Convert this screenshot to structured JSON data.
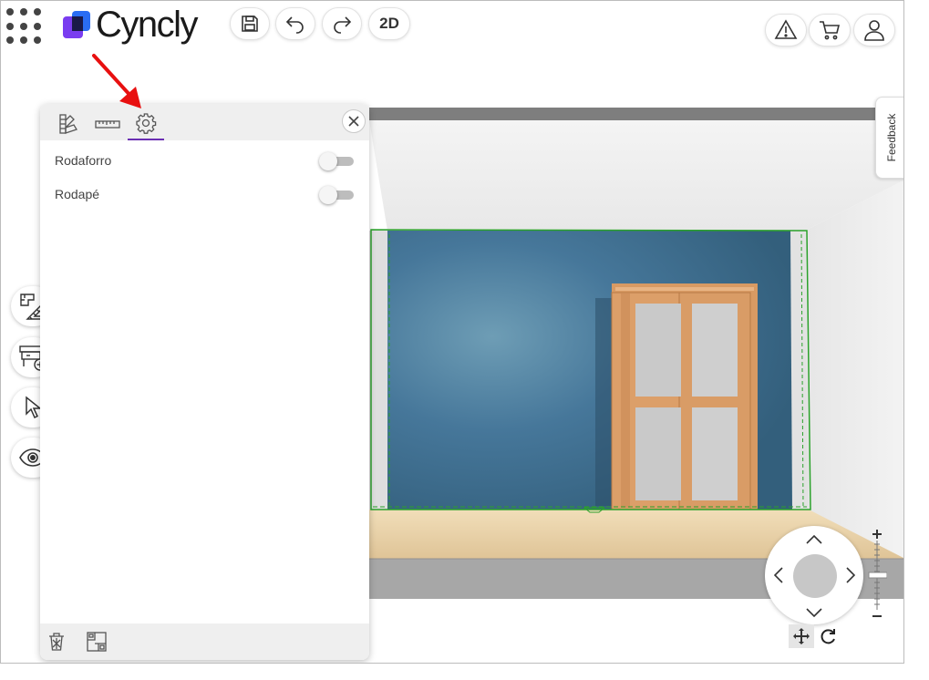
{
  "app": {
    "brand": "Cyncly",
    "colors": {
      "brand_purple": "#7a3df0",
      "brand_blue": "#2a6df4",
      "active_tab": "#6b2fb3",
      "wall": "#3d6b86",
      "floor": "#e7cfa5",
      "selection": "#2aa12a",
      "annotation": "#e81010"
    }
  },
  "header": {
    "apps_icon": "apps-grid-icon",
    "save_icon": "save-icon",
    "undo_icon": "undo-icon",
    "redo_icon": "redo-icon",
    "view_mode_label": "2D",
    "warning_icon": "warning-icon",
    "cart_icon": "cart-icon",
    "user_icon": "user-icon"
  },
  "panel": {
    "tabs": [
      {
        "icon": "materials-palette-icon",
        "active": false
      },
      {
        "icon": "ruler-icon",
        "active": false
      },
      {
        "icon": "gear-icon",
        "active": true
      }
    ],
    "close_icon": "close-icon",
    "settings": [
      {
        "label": "Rodaforro",
        "enabled": false
      },
      {
        "label": "Rodapé",
        "enabled": false
      }
    ],
    "footer": [
      {
        "icon": "trash-icon"
      },
      {
        "icon": "floorplan-icon"
      }
    ]
  },
  "left_rail": [
    {
      "icon": "floorplan-edit-icon"
    },
    {
      "icon": "add-furniture-icon"
    },
    {
      "icon": "cursor-select-icon"
    },
    {
      "icon": "eye-icon"
    }
  ],
  "feedback": {
    "label": "Feedback"
  },
  "navigation": {
    "arrows": [
      "up",
      "left",
      "right",
      "down"
    ],
    "modes": [
      {
        "icon": "move-icon",
        "active": true
      },
      {
        "icon": "rotate-icon",
        "active": false
      }
    ],
    "zoom": {
      "plus": "+",
      "minus": "−"
    }
  }
}
